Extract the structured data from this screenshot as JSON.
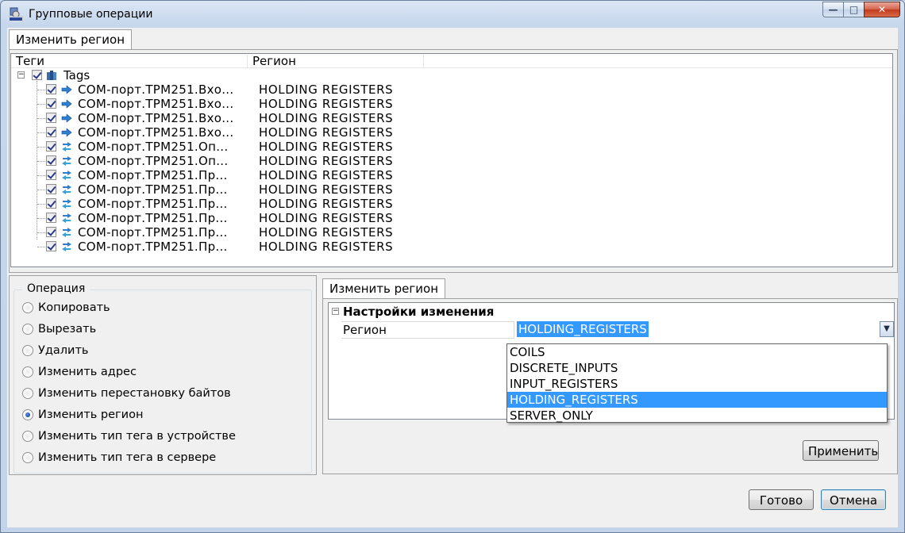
{
  "window": {
    "title": "Групповые операции",
    "close_symbol": "✕",
    "min_symbol": "—",
    "max_symbol": "□"
  },
  "top_tab": {
    "label": "Изменить регион"
  },
  "tree": {
    "columns": [
      "Теги",
      "Регион"
    ],
    "root": {
      "label": "Tags",
      "expander": "−"
    },
    "rows": [
      {
        "name": "COM-порт.ТРМ251.Вхо...",
        "region": "HOLDING  REGISTERS",
        "icon": "input-tag"
      },
      {
        "name": "COM-порт.ТРМ251.Вхо...",
        "region": "HOLDING  REGISTERS",
        "icon": "input-tag"
      },
      {
        "name": "COM-порт.ТРМ251.Вхо...",
        "region": "HOLDING  REGISTERS",
        "icon": "input-tag"
      },
      {
        "name": "COM-порт.ТРМ251.Вхо...",
        "region": "HOLDING  REGISTERS",
        "icon": "input-tag"
      },
      {
        "name": "COM-порт.ТРМ251.Оп...",
        "region": "HOLDING  REGISTERS",
        "icon": "io-tag"
      },
      {
        "name": "COM-порт.ТРМ251.Оп...",
        "region": "HOLDING  REGISTERS",
        "icon": "io-tag"
      },
      {
        "name": "COM-порт.ТРМ251.Пр...",
        "region": "HOLDING  REGISTERS",
        "icon": "io-tag"
      },
      {
        "name": "COM-порт.ТРМ251.Пр...",
        "region": "HOLDING  REGISTERS",
        "icon": "io-tag"
      },
      {
        "name": "COM-порт.ТРМ251.Пр...",
        "region": "HOLDING  REGISTERS",
        "icon": "io-tag"
      },
      {
        "name": "COM-порт.ТРМ251.Пр...",
        "region": "HOLDING  REGISTERS",
        "icon": "io-tag"
      },
      {
        "name": "COM-порт.ТРМ251.Пр...",
        "region": "HOLDING  REGISTERS",
        "icon": "io-tag"
      },
      {
        "name": "COM-порт.ТРМ251.Пр...",
        "region": "HOLDING  REGISTERS",
        "icon": "io-tag"
      }
    ]
  },
  "operations": {
    "title": "Операция",
    "items": [
      {
        "label": "Копировать",
        "checked": false
      },
      {
        "label": "Вырезать",
        "checked": false
      },
      {
        "label": "Удалить",
        "checked": false
      },
      {
        "label": "Изменить адрес",
        "checked": false
      },
      {
        "label": "Изменить перестановку байтов",
        "checked": false
      },
      {
        "label": "Изменить регион",
        "checked": true
      },
      {
        "label": "Изменить тип тега в устройстве",
        "checked": false
      },
      {
        "label": "Изменить тип тега в сервере",
        "checked": false
      }
    ]
  },
  "settings_tab": {
    "label": "Изменить регион"
  },
  "property_grid": {
    "category": "Настройки изменения",
    "category_expander": "−",
    "property_label": "Регион",
    "property_value": "HOLDING_REGISTERS",
    "dropdown_arrow": "▼",
    "options": [
      "COILS",
      "DISCRETE_INPUTS",
      "INPUT_REGISTERS",
      "HOLDING_REGISTERS",
      "SERVER_ONLY"
    ],
    "selected_option": "HOLDING_REGISTERS"
  },
  "buttons": {
    "apply": "Применить",
    "ok": "Готово",
    "cancel": "Отмена"
  },
  "colors": {
    "selection": "#3399ff",
    "window_frame": "#c6d7ec",
    "close_button": "#c2391e"
  }
}
